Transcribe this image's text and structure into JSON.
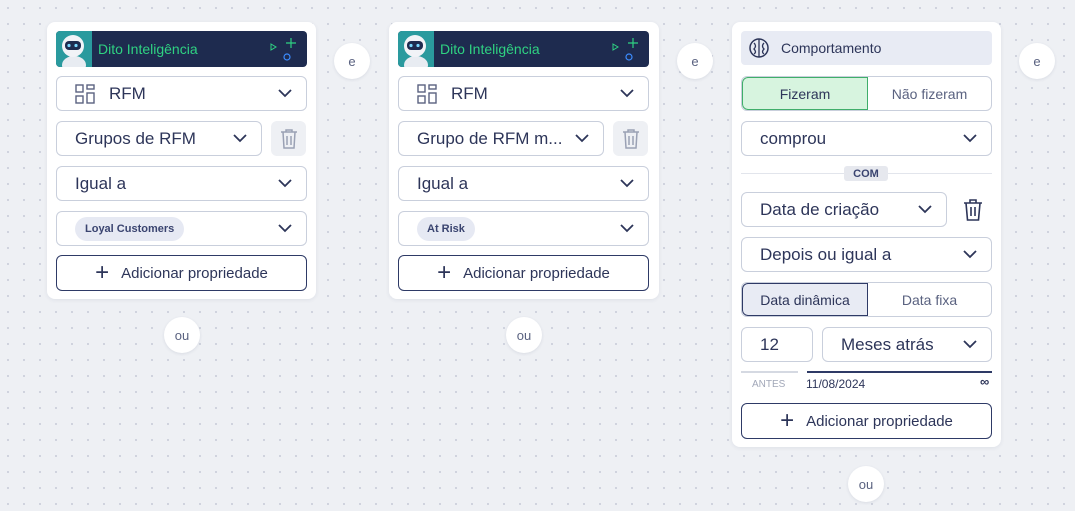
{
  "connectors": {
    "and_label": "e",
    "or_label": "ou"
  },
  "filter1": {
    "header_title": "Dito Inteligência",
    "category": "RFM",
    "property": "Grupos de RFM",
    "operator": "Igual a",
    "value_tag": "Loyal Customers",
    "add_property_label": "Adicionar propriedade"
  },
  "filter2": {
    "header_title": "Dito Inteligência",
    "category": "RFM",
    "property": "Grupo de RFM m...",
    "operator": "Igual a",
    "value_tag": "At Risk",
    "add_property_label": "Adicionar propriedade"
  },
  "filter3": {
    "header_title": "Comportamento",
    "toggle_done": "Fizeram",
    "toggle_not_done": "Não fizeram",
    "event": "comprou",
    "with_label": "COM",
    "property": "Data de criação",
    "operator": "Depois ou igual a",
    "date_dynamic": "Data dinâmica",
    "date_fixed": "Data fixa",
    "amount": "12",
    "unit": "Meses atrás",
    "before_label": "ANTES",
    "range_start": "11/08/2024",
    "range_end": "∞",
    "add_property_label": "Adicionar propriedade"
  },
  "colors": {
    "header_bg": "#1e2b4f",
    "header_text": "#2fd282",
    "active_toggle_bg": "#d7f4df",
    "active_toggle_border": "#3fae6a",
    "primary_text": "#2d3559"
  }
}
